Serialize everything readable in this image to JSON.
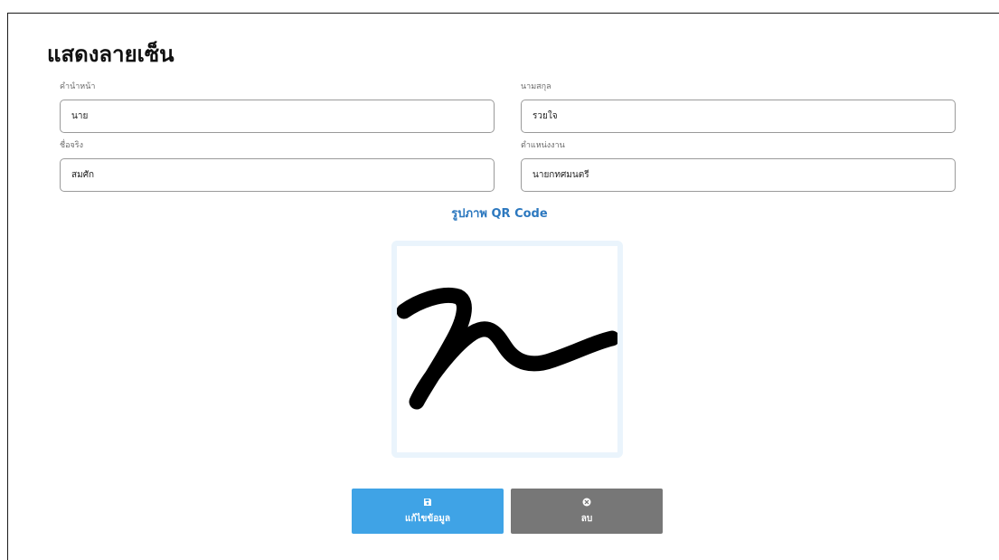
{
  "page": {
    "title": "แสดงลายเซ็น"
  },
  "form": {
    "prefix": {
      "label": "คำนำหน้า",
      "value": "นาย"
    },
    "lastname": {
      "label": "นามสกุล",
      "value": "รวยใจ"
    },
    "firstname": {
      "label": "ชื่อจริง",
      "value": "สมศัก"
    },
    "position": {
      "label": "ตำแหน่งงาน",
      "value": "นายกทศมนตรี"
    }
  },
  "signature": {
    "heading": "รูปภาพ QR Code",
    "image_kind": "handwritten-signature",
    "border_color": "#eaf4fc"
  },
  "actions": {
    "edit": {
      "label": "แก้ไขข้อมูล",
      "icon": "save-icon",
      "color": "#3fa3e6"
    },
    "delete": {
      "label": "ลบ",
      "icon": "close-circle-icon",
      "color": "#777777"
    }
  },
  "colors": {
    "accent": "#2c78bf",
    "title": "#111111"
  }
}
